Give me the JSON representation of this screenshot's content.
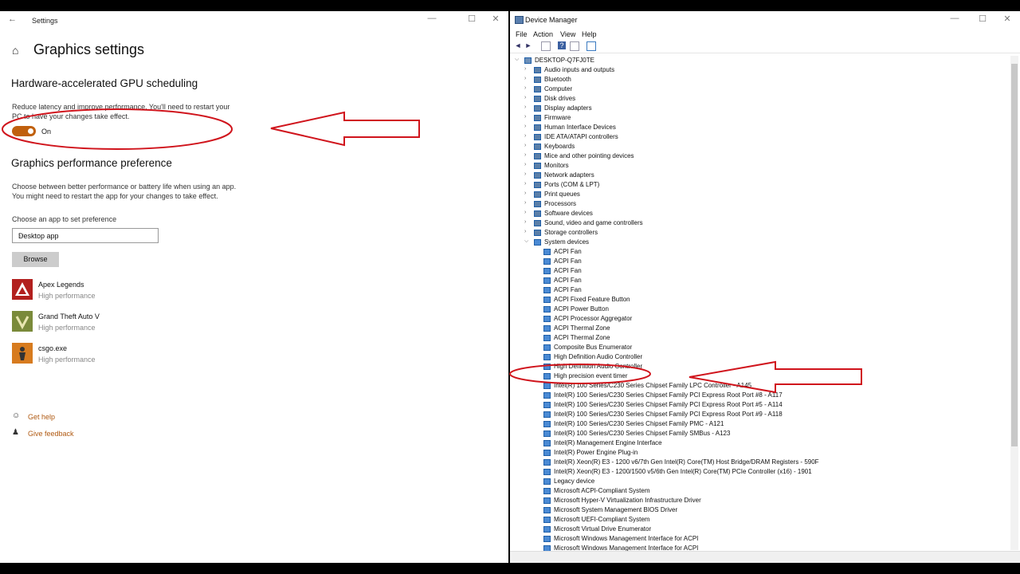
{
  "settings": {
    "window_title": "Settings",
    "page_title": "Graphics settings",
    "gpu_section_title": "Hardware-accelerated GPU scheduling",
    "gpu_desc_line1": "Reduce latency and improve performance. You'll need to restart your",
    "gpu_desc_line2": "PC to have your changes take effect.",
    "toggle_state": "On",
    "perf_section_title": "Graphics performance preference",
    "perf_desc_line1": "Choose between better performance or battery life when using an app.",
    "perf_desc_line2": "You might need to restart the app for your changes to take effect.",
    "choose_label": "Choose an app to set preference",
    "select_value": "Desktop app",
    "browse_label": "Browse",
    "apps": [
      {
        "name": "Apex Legends",
        "perf": "High performance"
      },
      {
        "name": "Grand Theft Auto V",
        "perf": "High performance"
      },
      {
        "name": "csgo.exe",
        "perf": "High performance"
      }
    ],
    "help_link": "Get help",
    "feedback_link": "Give feedback",
    "accent_color": "#c0600d"
  },
  "devmgr": {
    "window_title": "Device Manager",
    "menus": [
      "File",
      "Action",
      "View",
      "Help"
    ],
    "root": "DESKTOP-Q7FJ0TE",
    "categories": [
      "Audio inputs and outputs",
      "Bluetooth",
      "Computer",
      "Disk drives",
      "Display adapters",
      "Firmware",
      "Human Interface Devices",
      "IDE ATA/ATAPI controllers",
      "Keyboards",
      "Mice and other pointing devices",
      "Monitors",
      "Network adapters",
      "Ports (COM & LPT)",
      "Print queues",
      "Processors",
      "Software devices",
      "Sound, video and game controllers",
      "Storage controllers",
      "System devices"
    ],
    "system_devices": [
      "ACPI Fan",
      "ACPI Fan",
      "ACPI Fan",
      "ACPI Fan",
      "ACPI Fan",
      "ACPI Fixed Feature Button",
      "ACPI Power Button",
      "ACPI Processor Aggregator",
      "ACPI Thermal Zone",
      "ACPI Thermal Zone",
      "Composite Bus Enumerator",
      "High Definition Audio Controller",
      "High Definition Audio Controller",
      "High precision event timer",
      "Intel(R) 100 Series/C230 Series Chipset Family LPC Controller - A145",
      "Intel(R) 100 Series/C230 Series Chipset Family PCI Express Root Port #8 - A117",
      "Intel(R) 100 Series/C230 Series Chipset Family PCI Express Root Port #5 - A114",
      "Intel(R) 100 Series/C230 Series Chipset Family PCI Express Root Port #9 - A118",
      "Intel(R) 100 Series/C230 Series Chipset Family PMC - A121",
      "Intel(R) 100 Series/C230 Series Chipset Family SMBus - A123",
      "Intel(R) Management Engine Interface",
      "Intel(R) Power Engine Plug-in",
      "Intel(R) Xeon(R) E3 - 1200 v6/7th Gen Intel(R) Core(TM) Host Bridge/DRAM Registers - 590F",
      "Intel(R) Xeon(R) E3 - 1200/1500 v5/6th Gen Intel(R) Core(TM) PCIe Controller (x16) - 1901",
      "Legacy device",
      "Microsoft ACPI-Compliant System",
      "Microsoft Hyper-V Virtualization Infrastructure Driver",
      "Microsoft System Management BIOS Driver",
      "Microsoft UEFI-Compliant System",
      "Microsoft Virtual Drive Enumerator",
      "Microsoft Windows Management Interface for ACPI",
      "Microsoft Windows Management Interface for ACPI"
    ]
  },
  "annotation_color": "#d0141c"
}
